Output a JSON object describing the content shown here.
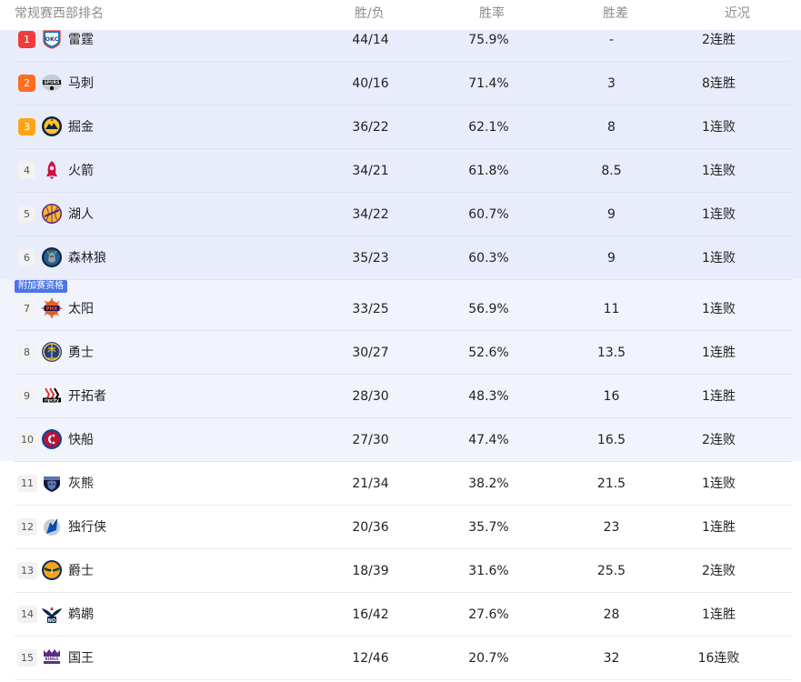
{
  "header": {
    "title": "常规赛西部排名",
    "record": "胜/负",
    "pct": "胜率",
    "gb": "胜差",
    "streak": "近况"
  },
  "playin_badge": "附加赛资格",
  "colors": {
    "direct_band": "#e8ecfb",
    "playin_band": "#f1f4fd",
    "rank1": "#f23b3b",
    "rank2": "#ff6d1f",
    "rank3": "#ffa51a",
    "badge": "#4b75e8"
  },
  "teams": [
    {
      "rank": "1",
      "name": "雷霆",
      "record": "44/14",
      "pct": "75.9%",
      "gb": "-",
      "streak": "2连胜",
      "icon": "thunder-logo-icon",
      "logo_text": "OKC"
    },
    {
      "rank": "2",
      "name": "马刺",
      "record": "40/16",
      "pct": "71.4%",
      "gb": "3",
      "streak": "8连胜",
      "icon": "spurs-logo-icon",
      "logo_text": "SPURS"
    },
    {
      "rank": "3",
      "name": "掘金",
      "record": "36/22",
      "pct": "62.1%",
      "gb": "8",
      "streak": "1连败",
      "icon": "nuggets-logo-icon",
      "logo_text": ""
    },
    {
      "rank": "4",
      "name": "火箭",
      "record": "34/21",
      "pct": "61.8%",
      "gb": "8.5",
      "streak": "1连败",
      "icon": "rockets-logo-icon",
      "logo_text": ""
    },
    {
      "rank": "5",
      "name": "湖人",
      "record": "34/22",
      "pct": "60.7%",
      "gb": "9",
      "streak": "1连败",
      "icon": "lakers-logo-icon",
      "logo_text": ""
    },
    {
      "rank": "6",
      "name": "森林狼",
      "record": "35/23",
      "pct": "60.3%",
      "gb": "9",
      "streak": "1连败",
      "icon": "timberwolves-logo-icon",
      "logo_text": ""
    },
    {
      "rank": "7",
      "name": "太阳",
      "record": "33/25",
      "pct": "56.9%",
      "gb": "11",
      "streak": "1连败",
      "icon": "suns-logo-icon",
      "logo_text": "PHX"
    },
    {
      "rank": "8",
      "name": "勇士",
      "record": "30/27",
      "pct": "52.6%",
      "gb": "13.5",
      "streak": "1连胜",
      "icon": "warriors-logo-icon",
      "logo_text": ""
    },
    {
      "rank": "9",
      "name": "开拓者",
      "record": "28/30",
      "pct": "48.3%",
      "gb": "16",
      "streak": "1连胜",
      "icon": "trail-blazers-logo-icon",
      "logo_text": "ripcity"
    },
    {
      "rank": "10",
      "name": "快船",
      "record": "27/30",
      "pct": "47.4%",
      "gb": "16.5",
      "streak": "2连败",
      "icon": "clippers-logo-icon",
      "logo_text": ""
    },
    {
      "rank": "11",
      "name": "灰熊",
      "record": "21/34",
      "pct": "38.2%",
      "gb": "21.5",
      "streak": "1连败",
      "icon": "grizzlies-logo-icon",
      "logo_text": ""
    },
    {
      "rank": "12",
      "name": "独行侠",
      "record": "20/36",
      "pct": "35.7%",
      "gb": "23",
      "streak": "1连胜",
      "icon": "mavericks-logo-icon",
      "logo_text": ""
    },
    {
      "rank": "13",
      "name": "爵士",
      "record": "18/39",
      "pct": "31.6%",
      "gb": "25.5",
      "streak": "2连败",
      "icon": "jazz-logo-icon",
      "logo_text": ""
    },
    {
      "rank": "14",
      "name": "鹈鹕",
      "record": "16/42",
      "pct": "27.6%",
      "gb": "28",
      "streak": "1连胜",
      "icon": "pelicans-logo-icon",
      "logo_text": "NO"
    },
    {
      "rank": "15",
      "name": "国王",
      "record": "12/46",
      "pct": "20.7%",
      "gb": "32",
      "streak": "16连败",
      "icon": "kings-logo-icon",
      "logo_text": "KINGS"
    }
  ]
}
